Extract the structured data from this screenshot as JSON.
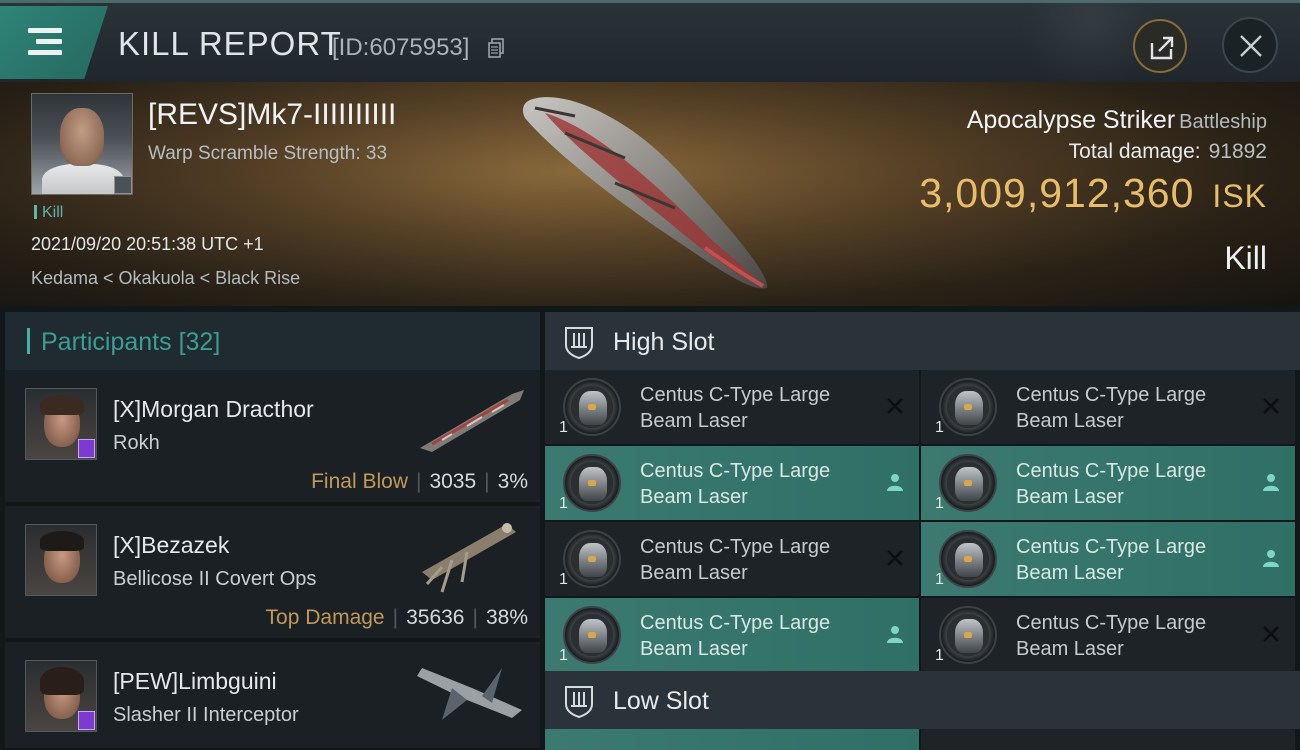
{
  "header": {
    "title": "KILL REPORT",
    "report_id": "[ID:6075953]"
  },
  "victim": {
    "name": "[REVS]Mk7-IIIIIIIIII",
    "warp_scramble": "Warp Scramble Strength: 33",
    "kill_tag": "Kill",
    "datetime": "2021/09/20 20:51:38 UTC +1",
    "location": "Kedama < Okakuola < Black Rise",
    "ship_name": "Apocalypse Striker",
    "ship_class": "Battleship",
    "total_damage_label": "Total damage:",
    "total_damage": "91892",
    "isk_value": "3,009,912,360",
    "isk_unit": "ISK",
    "result": "Kill"
  },
  "participants": {
    "label": "Participants",
    "count": "[32]",
    "rows": [
      {
        "name": "[X]Morgan Dracthor",
        "ship": "Rokh",
        "tag": "Final Blow",
        "damage": "3035",
        "percent": "3%"
      },
      {
        "name": "[X]Bezazek",
        "ship": "Bellicose II Covert Ops",
        "tag": "Top Damage",
        "damage": "35636",
        "percent": "38%"
      },
      {
        "name": "[PEW]Limbguini",
        "ship": "Slasher II Interceptor",
        "tag": "",
        "damage": "",
        "percent": ""
      }
    ]
  },
  "slots": {
    "high": {
      "label": "High Slot",
      "modules": [
        {
          "name": "Centus C-Type Large Beam Laser",
          "qty": "1",
          "state": "destroyed"
        },
        {
          "name": "Centus C-Type Large Beam Laser",
          "qty": "1",
          "state": "destroyed"
        },
        {
          "name": "Centus C-Type Large Beam Laser",
          "qty": "1",
          "state": "dropped"
        },
        {
          "name": "Centus C-Type Large Beam Laser",
          "qty": "1",
          "state": "dropped"
        },
        {
          "name": "Centus C-Type Large Beam Laser",
          "qty": "1",
          "state": "destroyed"
        },
        {
          "name": "Centus C-Type Large Beam Laser",
          "qty": "1",
          "state": "dropped"
        },
        {
          "name": "Centus C-Type Large Beam Laser",
          "qty": "1",
          "state": "dropped"
        },
        {
          "name": "Centus C-Type Large Beam Laser",
          "qty": "1",
          "state": "destroyed"
        }
      ]
    },
    "low": {
      "label": "Low Slot"
    }
  },
  "colors": {
    "accent_teal": "#3c9e92",
    "fitted_row": "#3c7a71",
    "isk_gold": "#e8bd6a",
    "tag_gold": "#c09a58",
    "corp_purple": "#7d3ad0"
  }
}
